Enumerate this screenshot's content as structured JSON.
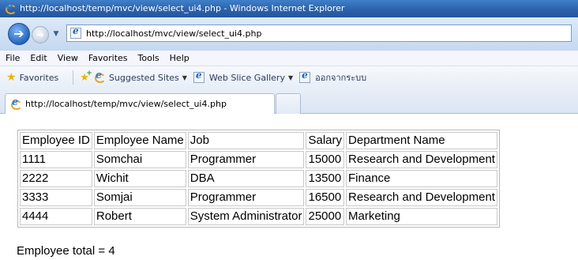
{
  "window": {
    "title": "http://localhost/temp/mvc/view/select_ui4.php - Windows Internet Explorer"
  },
  "address": {
    "url": "http://localhost/mvc/view/select_ui4.php"
  },
  "menu": [
    "File",
    "Edit",
    "View",
    "Favorites",
    "Tools",
    "Help"
  ],
  "favorites": {
    "label": "Favorites",
    "links": [
      "Suggested Sites",
      "Web Slice Gallery",
      "ออกจากระบบ"
    ]
  },
  "tab": {
    "label": "http://localhost/temp/mvc/view/select_ui4.php"
  },
  "table": {
    "headers": [
      "Employee ID",
      "Employee Name",
      "Job",
      "Salary",
      "Department Name"
    ],
    "rows": [
      [
        "1111",
        "Somchai",
        "Programmer",
        "15000",
        "Research and Development"
      ],
      [
        "2222",
        "Wichit",
        "DBA",
        "13500",
        "Finance"
      ],
      [
        "3333",
        "Somjai",
        "Programmer",
        "16500",
        "Research and Development"
      ],
      [
        "4444",
        "Robert",
        "System Administrator",
        "25000",
        "Marketing"
      ]
    ]
  },
  "footer": {
    "total_text": "Employee total = 4"
  },
  "icons": {
    "browser": "internet-explorer-icon",
    "back": "back-arrow-icon",
    "forward": "forward-arrow-icon",
    "favorites": "star-icon",
    "add_favorites": "add-to-favorites-icon",
    "page": "page-icon"
  }
}
